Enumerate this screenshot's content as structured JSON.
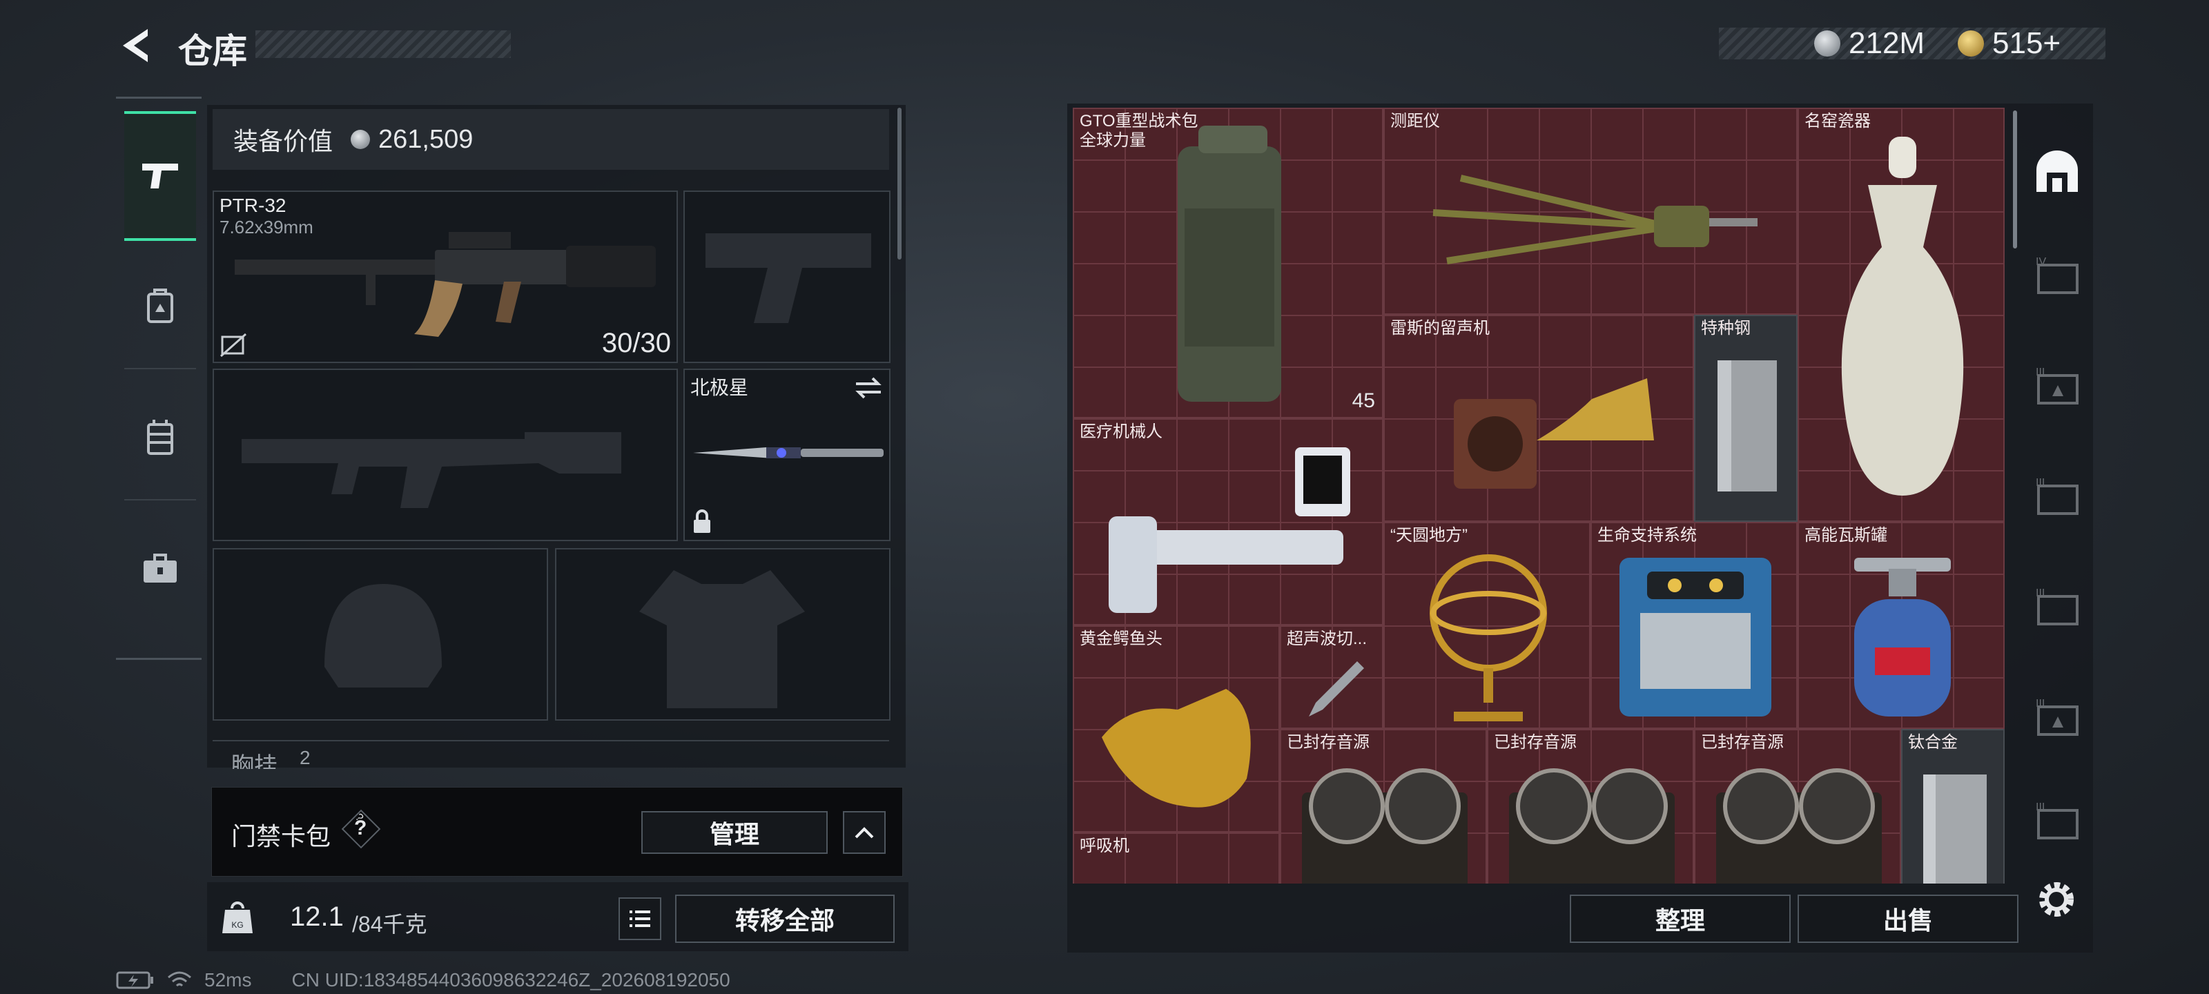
{
  "header": {
    "title": "仓库",
    "currency": [
      {
        "icon": "silver-coin-icon",
        "value": "212M"
      },
      {
        "icon": "gold-coin-icon",
        "value": "515+"
      }
    ]
  },
  "left_tabs": [
    {
      "name": "weapon",
      "icon": "pistol-icon"
    },
    {
      "name": "backpack",
      "icon": "backpack-icon"
    },
    {
      "name": "vest",
      "icon": "vest-icon"
    },
    {
      "name": "kit",
      "icon": "toolbox-icon"
    }
  ],
  "equipment": {
    "value_label": "装备价值",
    "value": "261,509",
    "primary_weapon": {
      "name": "PTR-32",
      "caliber": "7.62x39mm",
      "ammo": "30/30"
    },
    "melee": {
      "name": "北极星"
    },
    "chest_label": "胸挂",
    "chest_count": "2"
  },
  "keycard": {
    "label": "门禁卡包",
    "help": "?",
    "manage": "管理"
  },
  "footer_left": {
    "weight": "12.1",
    "weight_max": "/84千克",
    "transfer_all": "转移全部"
  },
  "grid_items": {
    "gto": {
      "name": "GTO重型战术包",
      "sub": "全球力量",
      "count": "45"
    },
    "rangefinder": {
      "name": "测距仪"
    },
    "vase": {
      "name": "名窑瓷器"
    },
    "gramophone": {
      "name": "雷斯的留声机"
    },
    "steel": {
      "name": "特种钢"
    },
    "medbot": {
      "name": "医疗机械人"
    },
    "armillary": {
      "name": "“天圆地方”"
    },
    "lifesupport": {
      "name": "生命支持系统"
    },
    "gas": {
      "name": "高能瓦斯罐"
    },
    "croc": {
      "name": "黄金鳄鱼头"
    },
    "ultrasonic": {
      "name": "超声波切..."
    },
    "reel1": {
      "name": "已封存音源"
    },
    "reel2": {
      "name": "已封存音源"
    },
    "reel3": {
      "name": "已封存音源"
    },
    "titanium": {
      "name": "钛合金"
    },
    "respirator": {
      "name": "呼吸机"
    }
  },
  "footer_right": {
    "sort": "整理",
    "sell": "出售"
  },
  "status": {
    "ping": "52ms",
    "uid": "CN UID:18348544036098632246Z_202608192050"
  }
}
